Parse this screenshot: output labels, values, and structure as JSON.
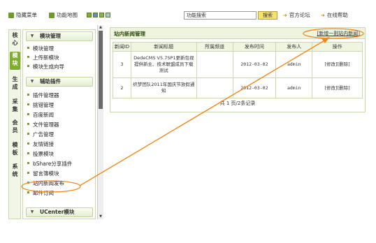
{
  "topbar": {
    "hide_menu": "隐藏菜单",
    "site_map": "功能地图",
    "search_value": "功能搜索",
    "search_button": "搜索",
    "forum": "官方论坛",
    "help": "在线帮助"
  },
  "vtabs": [
    "核心",
    "模块",
    "生成",
    "采集",
    "会员",
    "模板",
    "系统"
  ],
  "sidebar": {
    "section1": "模块管理",
    "section1_items": [
      "模块管理",
      "上传新模块",
      "模块生成向导"
    ],
    "section2": "辅助插件",
    "section2_items": [
      "插件管理器",
      "挑错管理",
      "百度新闻",
      "文件管理器",
      "广告管理",
      "友情链接",
      "投票模块",
      "bShare分享插件",
      "留言簿模块",
      "站内新闻发布",
      "邮件订阅"
    ],
    "section3": "UCenter模块"
  },
  "panel": {
    "title": "站内新闻管理",
    "add_link": "[新增一则站内新闻]",
    "columns": [
      "新闻ID",
      "新闻标题",
      "所属频道",
      "发布时间",
      "发布人",
      "操作"
    ],
    "rows": [
      {
        "id": "3",
        "title": "DedeCMS V5.7SP1更新包视提供新主、技术联盟成员下载测试",
        "channel": "",
        "date": "2012-03-02",
        "author": "admin",
        "actions": "[修改][删除]"
      },
      {
        "id": "2",
        "title": "织梦团队2011年国庆节放假通知",
        "channel": "",
        "date": "2012-03-02",
        "author": "admin",
        "actions": "[修改][删除]"
      }
    ],
    "pager": "共 1 页/2条记录"
  },
  "colors": {
    "accent_green": "#7fae2f",
    "annotation_orange": "#f08a1c",
    "search_button": "#f6e46a"
  },
  "icons": [
    "hide-menu-icon",
    "site-map-icon",
    "forum-icon",
    "help-icon"
  ]
}
